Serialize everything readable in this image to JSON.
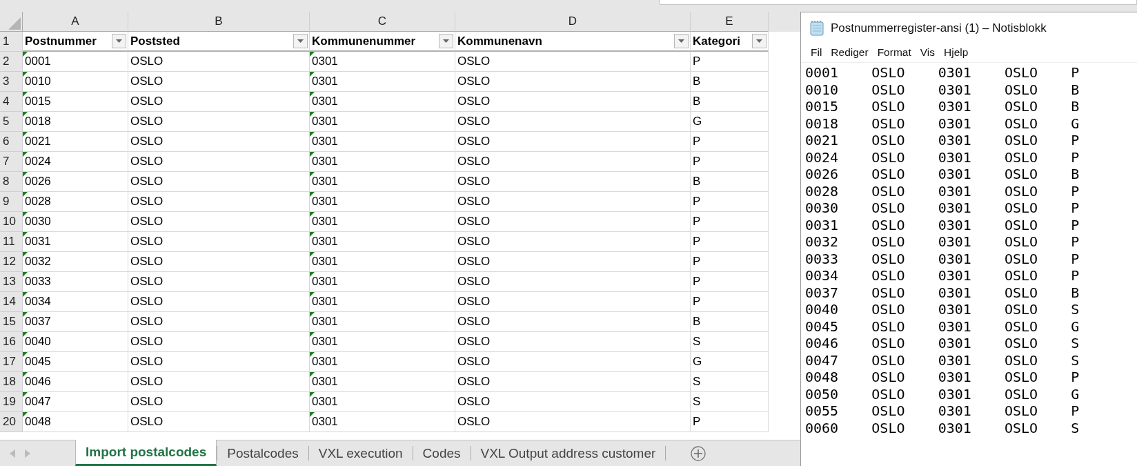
{
  "spreadsheet": {
    "columns": [
      {
        "letter": "A",
        "header": "Postnummer",
        "flagged": true
      },
      {
        "letter": "B",
        "header": "Poststed",
        "flagged": false
      },
      {
        "letter": "C",
        "header": "Kommunenummer",
        "flagged": true
      },
      {
        "letter": "D",
        "header": "Kommunenavn",
        "flagged": false
      },
      {
        "letter": "E",
        "header": "Kategori",
        "flagged": false
      }
    ],
    "rows": [
      {
        "number": "1"
      },
      {
        "number": "2",
        "cells": [
          "0001",
          "OSLO",
          "0301",
          "OSLO",
          "P"
        ]
      },
      {
        "number": "3",
        "cells": [
          "0010",
          "OSLO",
          "0301",
          "OSLO",
          "B"
        ]
      },
      {
        "number": "4",
        "cells": [
          "0015",
          "OSLO",
          "0301",
          "OSLO",
          "B"
        ]
      },
      {
        "number": "5",
        "cells": [
          "0018",
          "OSLO",
          "0301",
          "OSLO",
          "G"
        ]
      },
      {
        "number": "6",
        "cells": [
          "0021",
          "OSLO",
          "0301",
          "OSLO",
          "P"
        ]
      },
      {
        "number": "7",
        "cells": [
          "0024",
          "OSLO",
          "0301",
          "OSLO",
          "P"
        ]
      },
      {
        "number": "8",
        "cells": [
          "0026",
          "OSLO",
          "0301",
          "OSLO",
          "B"
        ]
      },
      {
        "number": "9",
        "cells": [
          "0028",
          "OSLO",
          "0301",
          "OSLO",
          "P"
        ]
      },
      {
        "number": "10",
        "cells": [
          "0030",
          "OSLO",
          "0301",
          "OSLO",
          "P"
        ]
      },
      {
        "number": "11",
        "cells": [
          "0031",
          "OSLO",
          "0301",
          "OSLO",
          "P"
        ]
      },
      {
        "number": "12",
        "cells": [
          "0032",
          "OSLO",
          "0301",
          "OSLO",
          "P"
        ]
      },
      {
        "number": "13",
        "cells": [
          "0033",
          "OSLO",
          "0301",
          "OSLO",
          "P"
        ]
      },
      {
        "number": "14",
        "cells": [
          "0034",
          "OSLO",
          "0301",
          "OSLO",
          "P"
        ]
      },
      {
        "number": "15",
        "cells": [
          "0037",
          "OSLO",
          "0301",
          "OSLO",
          "B"
        ]
      },
      {
        "number": "16",
        "cells": [
          "0040",
          "OSLO",
          "0301",
          "OSLO",
          "S"
        ]
      },
      {
        "number": "17",
        "cells": [
          "0045",
          "OSLO",
          "0301",
          "OSLO",
          "G"
        ]
      },
      {
        "number": "18",
        "cells": [
          "0046",
          "OSLO",
          "0301",
          "OSLO",
          "S"
        ]
      },
      {
        "number": "19",
        "cells": [
          "0047",
          "OSLO",
          "0301",
          "OSLO",
          "S"
        ]
      },
      {
        "number": "20",
        "cells": [
          "0048",
          "OSLO",
          "0301",
          "OSLO",
          "P"
        ]
      }
    ],
    "sheet_tabs": [
      {
        "label": "Import postalcodes",
        "selected": true
      },
      {
        "label": "Postalcodes",
        "selected": false
      },
      {
        "label": "VXL execution",
        "selected": false
      },
      {
        "label": "Codes",
        "selected": false
      },
      {
        "label": "VXL Output address customer",
        "selected": false
      }
    ]
  },
  "notepad": {
    "title": "Postnummerregister-ansi (1) – Notisblokk",
    "menu": [
      "Fil",
      "Rediger",
      "Format",
      "Vis",
      "Hjelp"
    ],
    "lines": [
      "0001\tOSLO\t0301\tOSLO\tP",
      "0010\tOSLO\t0301\tOSLO\tB",
      "0015\tOSLO\t0301\tOSLO\tB",
      "0018\tOSLO\t0301\tOSLO\tG",
      "0021\tOSLO\t0301\tOSLO\tP",
      "0024\tOSLO\t0301\tOSLO\tP",
      "0026\tOSLO\t0301\tOSLO\tB",
      "0028\tOSLO\t0301\tOSLO\tP",
      "0030\tOSLO\t0301\tOSLO\tP",
      "0031\tOSLO\t0301\tOSLO\tP",
      "0032\tOSLO\t0301\tOSLO\tP",
      "0033\tOSLO\t0301\tOSLO\tP",
      "0034\tOSLO\t0301\tOSLO\tP",
      "0037\tOSLO\t0301\tOSLO\tB",
      "0040\tOSLO\t0301\tOSLO\tS",
      "0045\tOSLO\t0301\tOSLO\tG",
      "0046\tOSLO\t0301\tOSLO\tS",
      "0047\tOSLO\t0301\tOSLO\tS",
      "0048\tOSLO\t0301\tOSLO\tP",
      "0050\tOSLO\t0301\tOSLO\tG",
      "0055\tOSLO\t0301\tOSLO\tP",
      "0060\tOSLO\t0301\tOSLO\tS"
    ]
  }
}
